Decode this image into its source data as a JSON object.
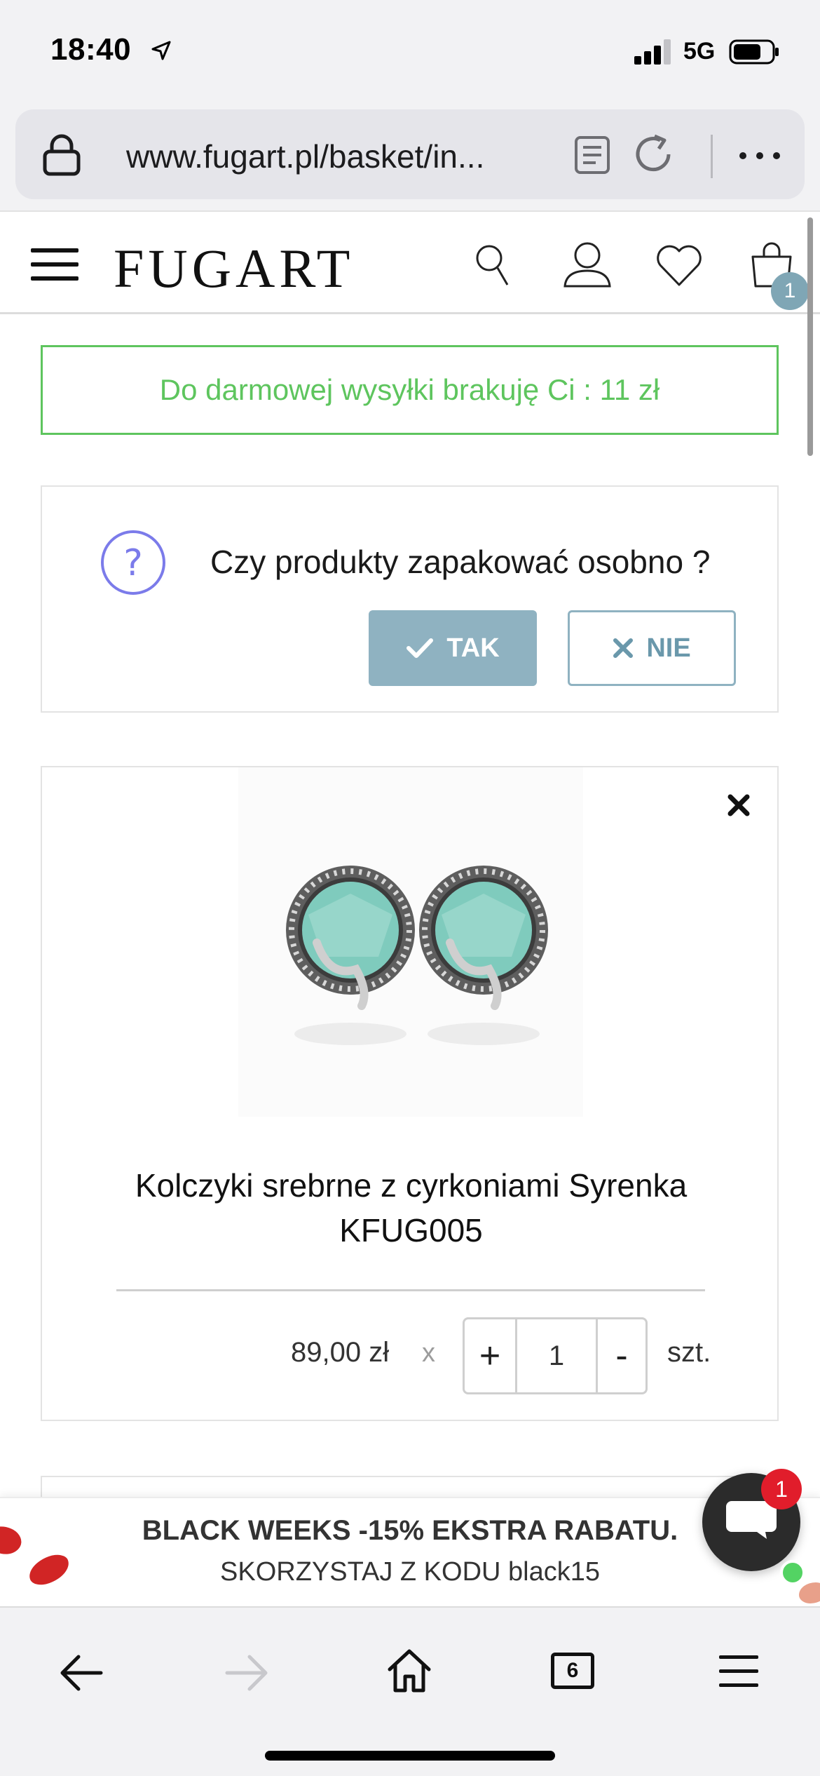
{
  "status_bar": {
    "time": "18:40",
    "network": "5G",
    "signal_bars_active": 3,
    "signal_bars_total": 4
  },
  "browser": {
    "url": "www.fugart.pl/basket/in...",
    "open_tabs_count": "6"
  },
  "header": {
    "logo": "FUGART",
    "cart_count": "1"
  },
  "shipping_notice": {
    "text": "Do darmowej wysyłki brakuję Ci : 11 zł"
  },
  "pack_separately": {
    "question": "Czy produkty zapakować osobno ?",
    "yes_label": "TAK",
    "no_label": "NIE"
  },
  "basket_items": [
    {
      "name_line1": "Kolczyki srebrne z cyrkoniami Syrenka",
      "name_line2": "KFUG005",
      "price": "89,00 zł",
      "times": "x",
      "plus": "+",
      "quantity": "1",
      "minus": "-",
      "unit": "szt."
    }
  ],
  "promo": {
    "line1": "BLACK WEEKS -15% EKSTRA RABATU.",
    "line2": "SKORZYSTAJ Z KODU black15"
  },
  "chat": {
    "unread_count": "1"
  },
  "colors": {
    "accent": "#8fb2c1",
    "notice_green": "#5ec55e",
    "badge_red": "#e11d2b",
    "online_green": "#53d363"
  },
  "icons": {
    "question": "question-mark-icon",
    "yes": "checkmark-icon",
    "no": "cross-icon",
    "search": "search-icon",
    "account": "user-icon",
    "wishlist": "heart-icon",
    "cart": "shopping-bag-icon"
  }
}
